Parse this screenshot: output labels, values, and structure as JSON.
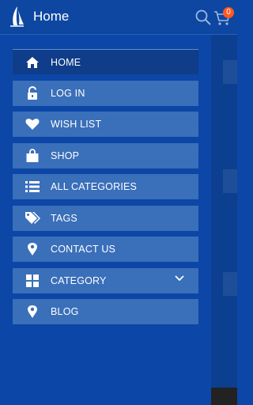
{
  "header": {
    "title": "Home",
    "cart_count": "0",
    "logo_icon": "sail-logo-icon",
    "search_icon": "search-icon",
    "cart_icon": "cart-icon"
  },
  "menu": {
    "items": [
      {
        "label": "HOME",
        "icon": "home-icon",
        "active": true
      },
      {
        "label": "LOG IN",
        "icon": "unlock-icon"
      },
      {
        "label": "WISH LIST",
        "icon": "heart-icon"
      },
      {
        "label": "SHOP",
        "icon": "shopping-bag-icon"
      },
      {
        "label": "ALL CATEGORIES",
        "icon": "list-icon"
      },
      {
        "label": "TAGS",
        "icon": "tags-icon"
      },
      {
        "label": "CONTACT US",
        "icon": "map-pin-icon"
      },
      {
        "label": "CATEGORY",
        "icon": "grid-icon",
        "expandable": true
      },
      {
        "label": "BLOG",
        "icon": "map-pin-icon"
      }
    ]
  },
  "colors": {
    "background": "#0c46a6",
    "menu_item": "#3a6fba",
    "menu_item_active": "#0f3d8a",
    "badge": "#ff5722"
  }
}
